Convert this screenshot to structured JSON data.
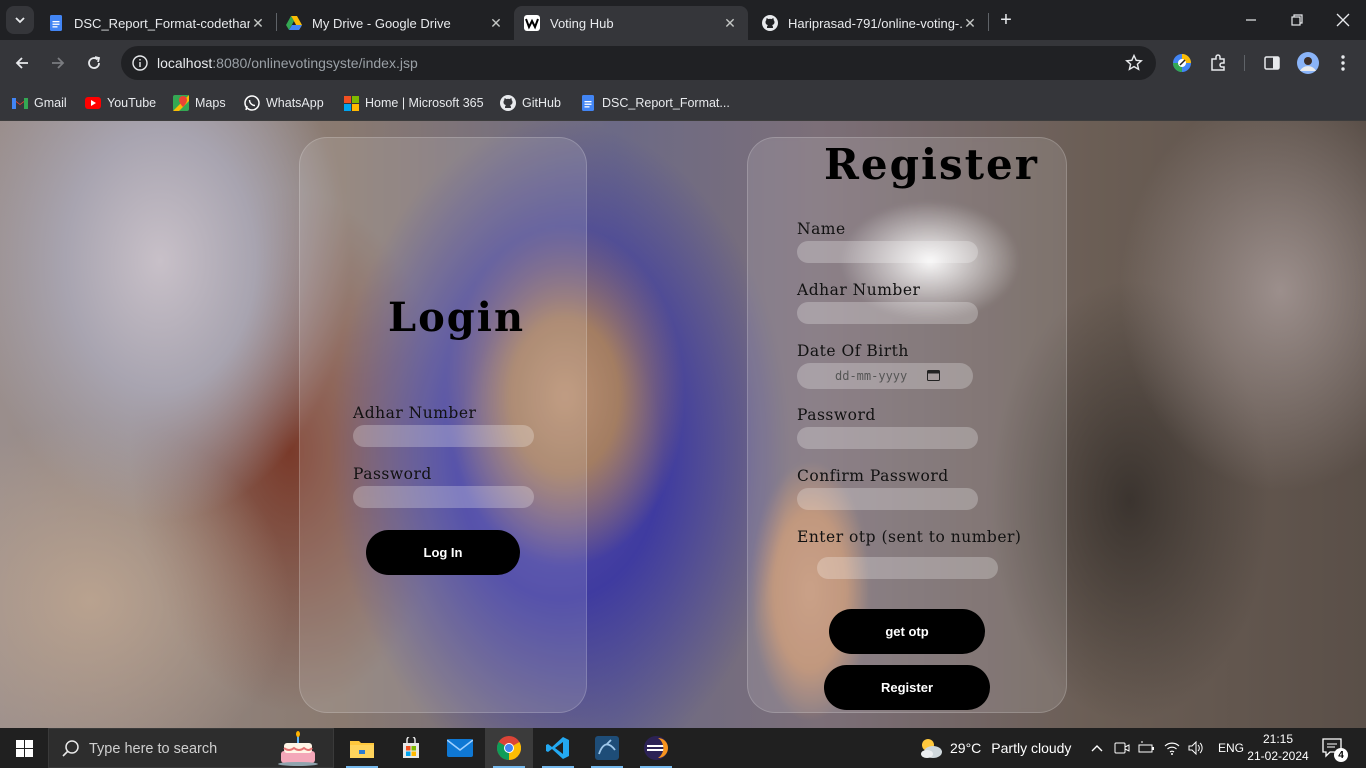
{
  "browser": {
    "tabs": [
      {
        "title": "DSC_Report_Format-codethan...",
        "icon": "google-docs-icon",
        "active": false
      },
      {
        "title": "My Drive - Google Drive",
        "icon": "google-drive-icon",
        "active": false
      },
      {
        "title": "Voting Hub",
        "icon": "voting-hub-icon",
        "active": true
      },
      {
        "title": "Hariprasad-791/online-voting-...",
        "icon": "github-icon",
        "active": false
      }
    ],
    "address": {
      "host": "localhost",
      "path": ":8080/onlinevotingsyste/index.jsp"
    },
    "bookmarks": [
      {
        "label": "Gmail",
        "icon": "gmail-icon"
      },
      {
        "label": "YouTube",
        "icon": "youtube-icon"
      },
      {
        "label": "Maps",
        "icon": "maps-icon"
      },
      {
        "label": "WhatsApp",
        "icon": "whatsapp-icon"
      },
      {
        "label": "Home | Microsoft 365",
        "icon": "microsoft-icon"
      },
      {
        "label": "GitHub",
        "icon": "github-icon"
      },
      {
        "label": "DSC_Report_Format...",
        "icon": "google-docs-icon"
      }
    ]
  },
  "login": {
    "title": "Login",
    "adhar_label": "Adhar Number",
    "password_label": "Password",
    "adhar_value": "",
    "password_value": "",
    "button": "Log In"
  },
  "register": {
    "title": "Register",
    "name_label": "Name",
    "adhar_label": "Adhar Number",
    "dob_label": "Date Of Birth",
    "dob_placeholder": "dd-mm-yyyy",
    "password_label": "Password",
    "confirm_label": "Confirm Password",
    "otp_label": "Enter otp (sent to number)",
    "otp_button": "get otp",
    "register_button": "Register"
  },
  "taskbar": {
    "search_placeholder": "Type here to search",
    "weather_temp": "29°C",
    "weather_text": "Partly cloudy",
    "language": "ENG",
    "time": "21:15",
    "date": "21-02-2024",
    "notification_count": "4"
  }
}
